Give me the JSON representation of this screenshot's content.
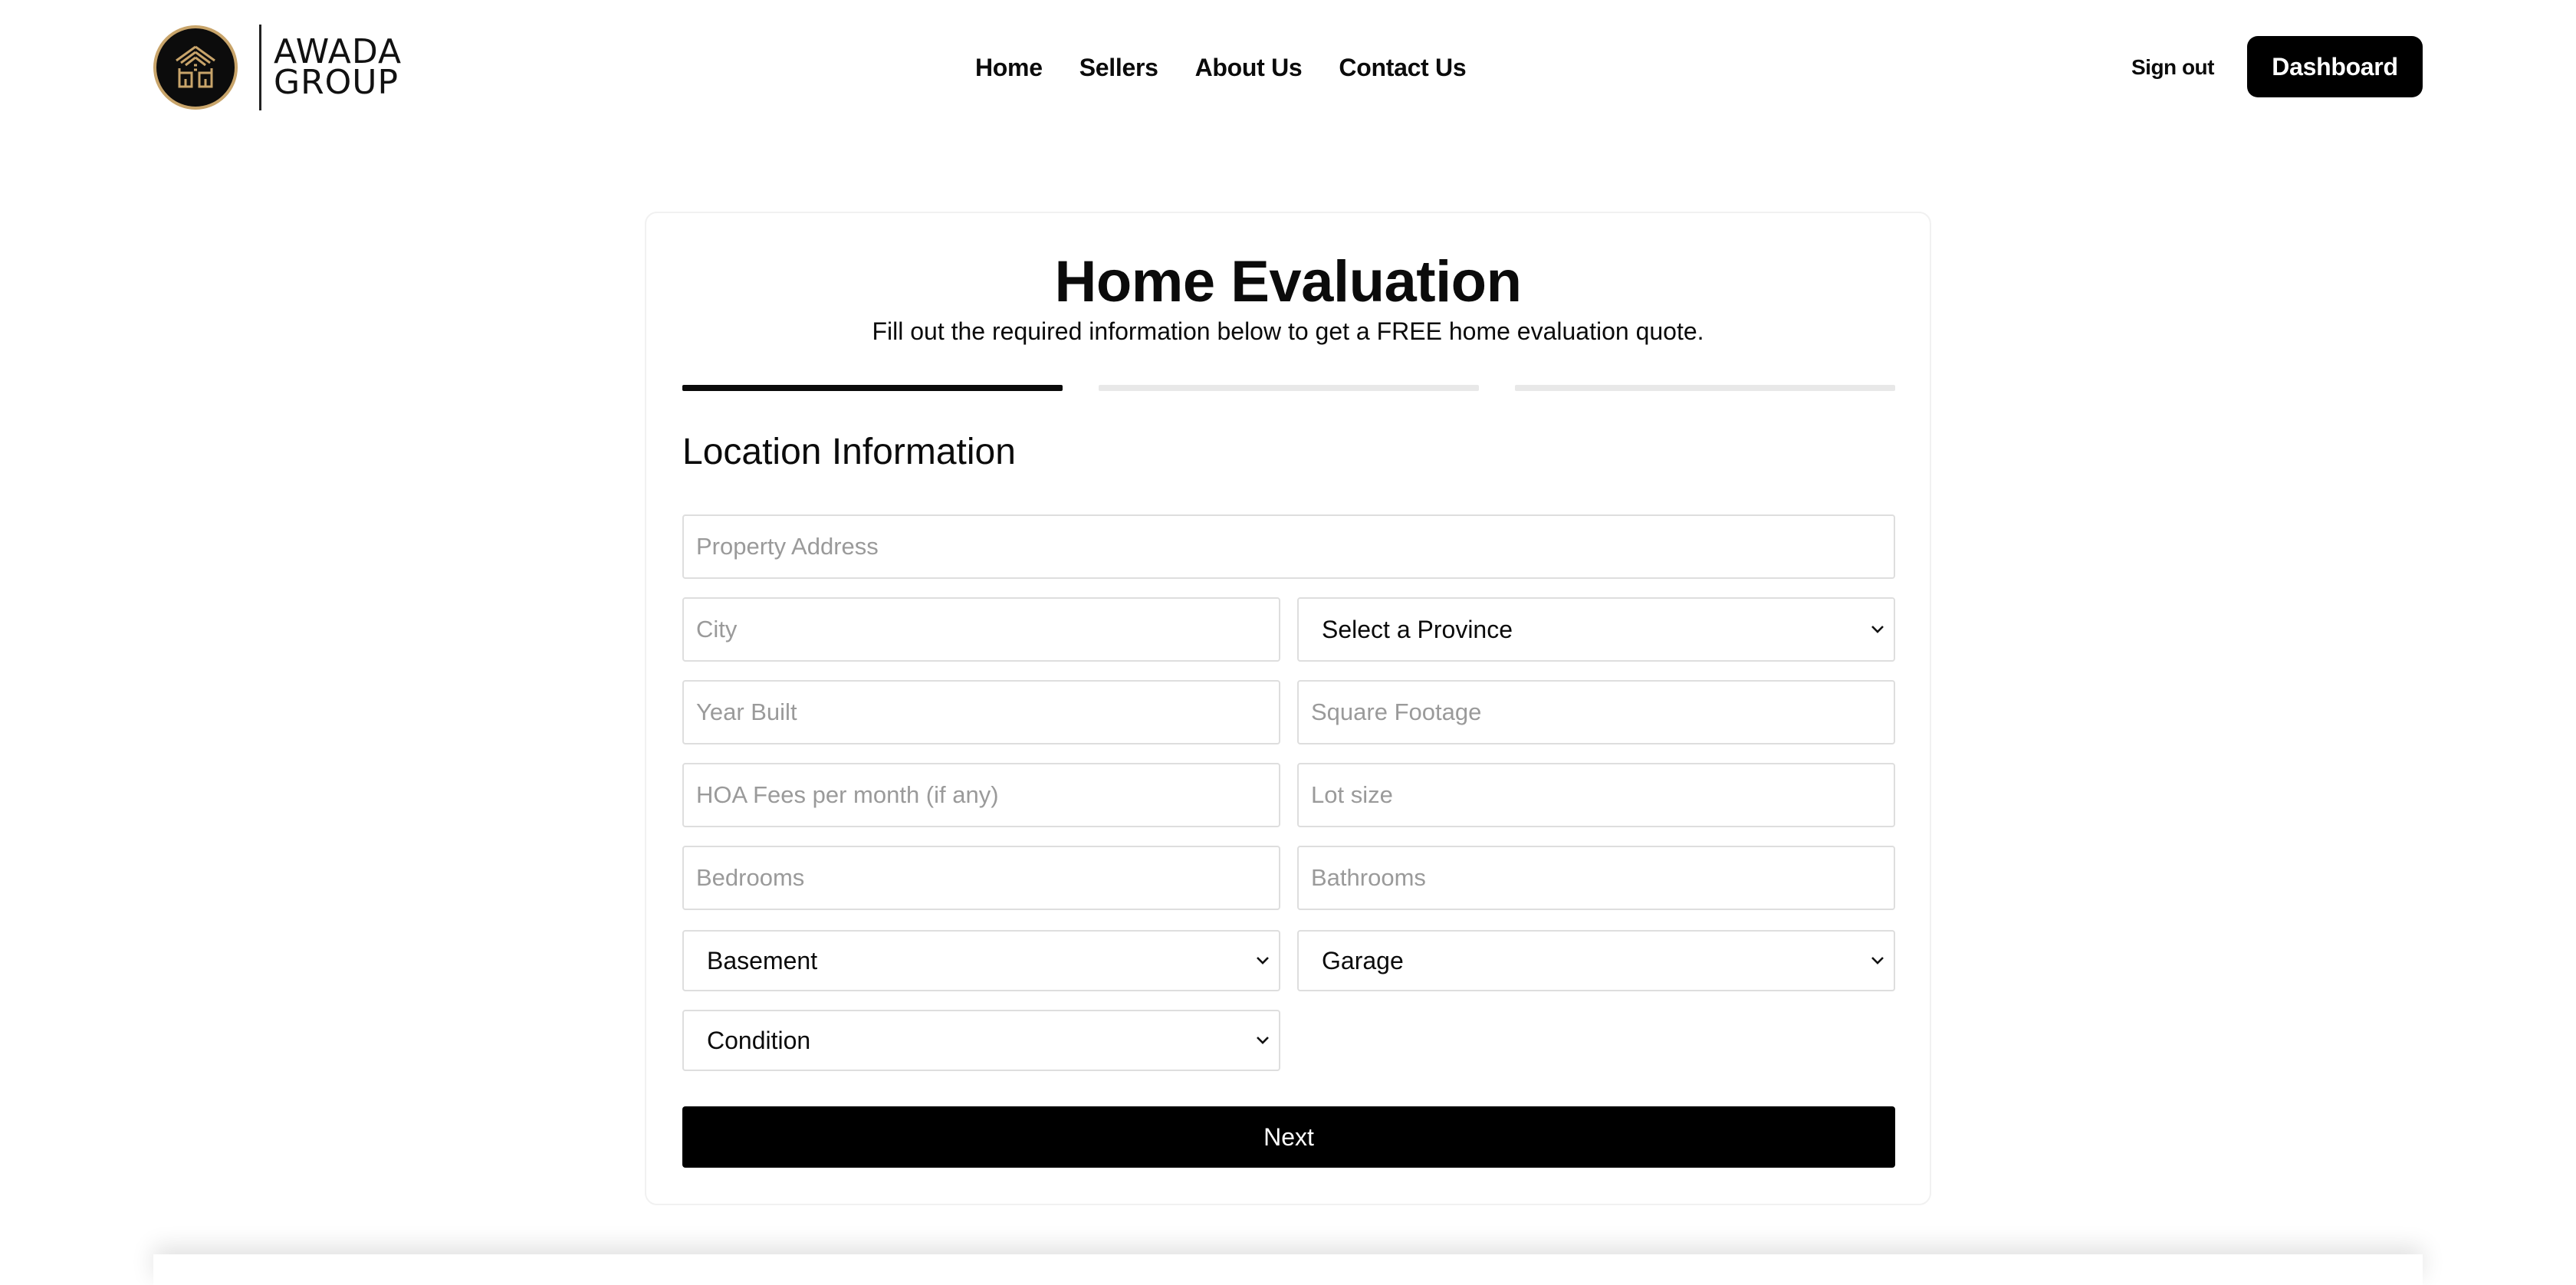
{
  "brand": {
    "line1": "AWADA",
    "line2": "GROUP",
    "accent_color": "#c8a46a"
  },
  "nav": {
    "items": [
      {
        "label": "Home"
      },
      {
        "label": "Sellers"
      },
      {
        "label": "About Us"
      },
      {
        "label": "Contact Us"
      }
    ],
    "sign_out": "Sign out",
    "dashboard": "Dashboard"
  },
  "form": {
    "title": "Home Evaluation",
    "subtitle": "Fill out the required information below to get a FREE home evaluation quote.",
    "steps_total": 3,
    "current_step": 1,
    "section_title": "Location Information",
    "fields": {
      "property_address": "Property Address",
      "city": "City",
      "year_built": "Year Built",
      "square_footage": "Square Footage",
      "hoa_fees": "HOA Fees per month (if any)",
      "lot_size": "Lot size",
      "bedrooms": "Bedrooms",
      "bathrooms": "Bathrooms"
    },
    "selects": {
      "province": "Select a Province",
      "basement": "Basement",
      "garage": "Garage",
      "condition": "Condition"
    },
    "next_label": "Next"
  }
}
